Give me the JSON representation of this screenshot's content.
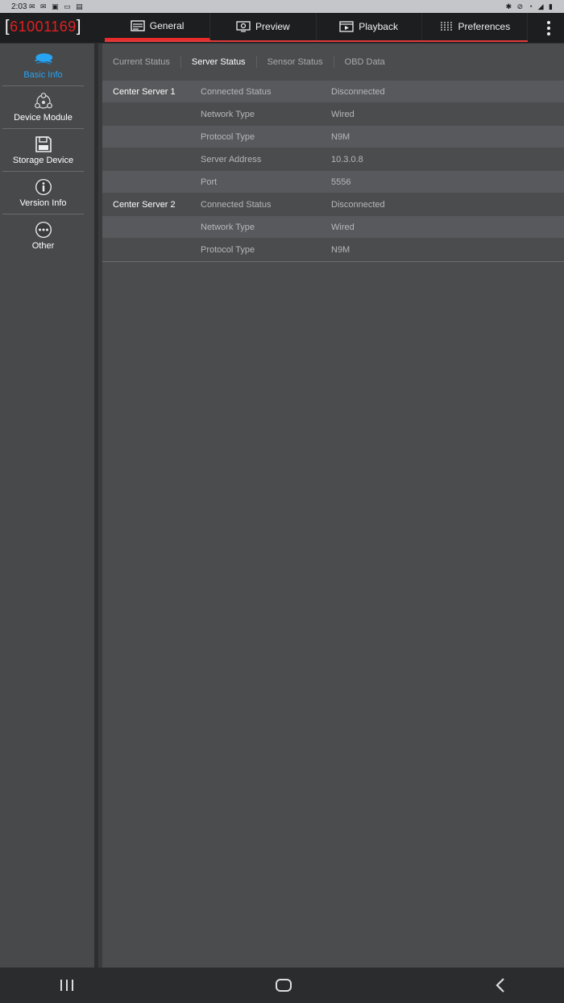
{
  "status_bar": {
    "time": "2:03",
    "notification_icons": "✉ ✉ ▣ ▭ ▤",
    "system_icons": "✱ ⊘ ◔ ◢ ▮"
  },
  "app": {
    "device_id": "61001169",
    "bracket_left": "[",
    "bracket_right": "]"
  },
  "top_nav": {
    "tabs": [
      {
        "label": "General",
        "icon": "general-icon",
        "active": true
      },
      {
        "label": "Preview",
        "icon": "preview-icon",
        "active": false
      },
      {
        "label": "Playback",
        "icon": "playback-icon",
        "active": false
      },
      {
        "label": "Preferences",
        "icon": "preferences-icon",
        "active": false
      }
    ]
  },
  "sidebar": {
    "items": [
      {
        "label": "Basic Info",
        "icon": "basic-info-icon",
        "active": true
      },
      {
        "label": "Device Module",
        "icon": "device-module-icon",
        "active": false
      },
      {
        "label": "Storage Device",
        "icon": "storage-device-icon",
        "active": false
      },
      {
        "label": "Version Info",
        "icon": "info-icon",
        "active": false
      },
      {
        "label": "Other",
        "icon": "more-icon",
        "active": false
      }
    ]
  },
  "sub_tabs": [
    {
      "label": "Current Status",
      "active": false
    },
    {
      "label": "Server Status",
      "active": true
    },
    {
      "label": "Sensor Status",
      "active": false
    },
    {
      "label": "OBD Data",
      "active": false
    }
  ],
  "server_table": [
    {
      "group": "Center Server 1",
      "key": "Connected Status",
      "value": "Disconnected"
    },
    {
      "group": "",
      "key": "Network Type",
      "value": "Wired"
    },
    {
      "group": "",
      "key": "Protocol Type",
      "value": "N9M"
    },
    {
      "group": "",
      "key": "Server Address",
      "value": "10.3.0.8"
    },
    {
      "group": "",
      "key": "Port",
      "value": "5556"
    },
    {
      "group": "Center Server 2",
      "key": "Connected Status",
      "value": "Disconnected"
    },
    {
      "group": "",
      "key": "Network Type",
      "value": "Wired"
    },
    {
      "group": "",
      "key": "Protocol Type",
      "value": "N9M"
    }
  ],
  "colors": {
    "accent_red": "#e82a2a",
    "active_blue": "#27a4f3"
  }
}
